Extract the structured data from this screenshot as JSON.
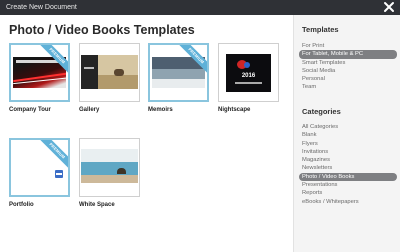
{
  "window": {
    "title": "Create New Document"
  },
  "main": {
    "title": "Photo / Video Books Templates",
    "templates": [
      {
        "label": "Company Tour",
        "ribbon": "PREMIUM"
      },
      {
        "label": "Gallery"
      },
      {
        "label": "Memoirs",
        "ribbon": "PREMIUM"
      },
      {
        "label": "Nightscape",
        "thumb_text": "2016"
      },
      {
        "label": "Portfolio",
        "ribbon": "PREMIUM"
      },
      {
        "label": "White Space"
      }
    ]
  },
  "sidebar": {
    "templates_title": "Templates",
    "templates_items": [
      "For Print",
      "For Tablet, Mobile & PC",
      "Smart Templates",
      "Social Media",
      "Personal",
      "Team"
    ],
    "templates_active": "For Tablet, Mobile & PC",
    "categories_title": "Categories",
    "categories_items": [
      "All Categories",
      "Blank",
      "Flyers",
      "Invitations",
      "Magazines",
      "Newsletters",
      "Photo / Video Books",
      "Presentations",
      "Reports",
      "eBooks / Whitepapers"
    ],
    "categories_active": "Photo / Video Books"
  },
  "colors": {
    "titlebar": "#2f3136",
    "selection_border": "#8ac5de",
    "ribbon": "#5fb1d8",
    "active_item": "#7e7f82"
  }
}
